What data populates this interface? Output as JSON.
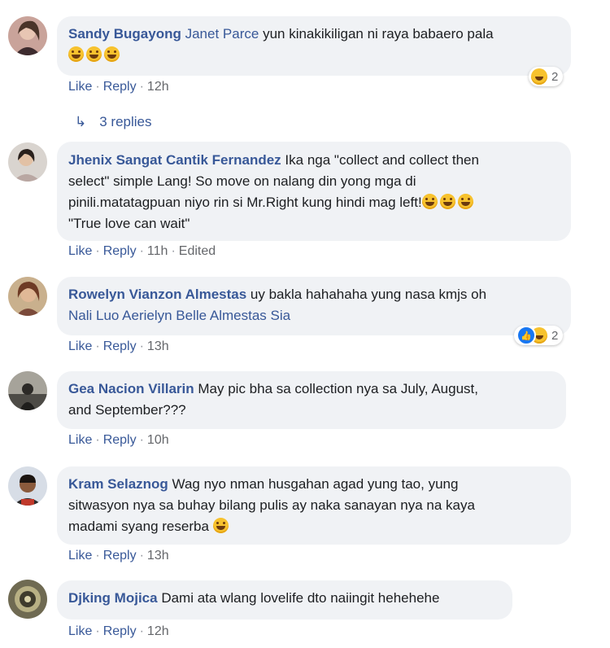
{
  "comments": [
    {
      "author": "Sandy Bugayong",
      "mention": "Janet Parce",
      "text": "yun kinakikiligan ni raya babaero pala",
      "emojis": "grinning-squinting-face x3",
      "like": "Like",
      "reply": "Reply",
      "time": "12h",
      "edited": "",
      "reaction_count": "2",
      "reactions": [
        "haha-icon"
      ],
      "replies_label": "3 replies"
    },
    {
      "author": "Jhenix Sangat Cantik Fernandez",
      "line1": "Ika nga \"collect and collect then",
      "line2": "select\" simple Lang! So move on nalang din yong mga di",
      "line3": "pinili.matatagpuan niyo rin si Mr.Right kung hindi mag left!",
      "line4": "\"True love can wait\"",
      "like": "Like",
      "reply": "Reply",
      "time": "11h",
      "edited": "Edited"
    },
    {
      "author": "Rowelyn Vianzon Almestas",
      "text": "uy bakla hahahaha yung nasa kmjs oh",
      "mention": "Nali Luo Aerielyn Belle Almestas Sia",
      "like": "Like",
      "reply": "Reply",
      "time": "13h",
      "reaction_count": "2",
      "reactions": [
        "like-icon",
        "haha-icon"
      ]
    },
    {
      "author": "Gea Nacion Villarin",
      "line1": "May pic bha sa collection nya sa July, August,",
      "line2": "and September???",
      "like": "Like",
      "reply": "Reply",
      "time": "10h"
    },
    {
      "author": "Kram Selaznog",
      "line1": "Wag nyo nman husgahan agad yung tao, yung",
      "line2": "sitwasyon nya sa buhay bilang pulis ay naka sanayan nya na kaya",
      "line3": "madami syang reserba",
      "like": "Like",
      "reply": "Reply",
      "time": "13h"
    },
    {
      "author": "Djking Mojica",
      "text": "Dami ata wlang lovelife dto naiingit hehehehe",
      "like": "Like",
      "reply": "Reply",
      "time": "12h"
    }
  ]
}
